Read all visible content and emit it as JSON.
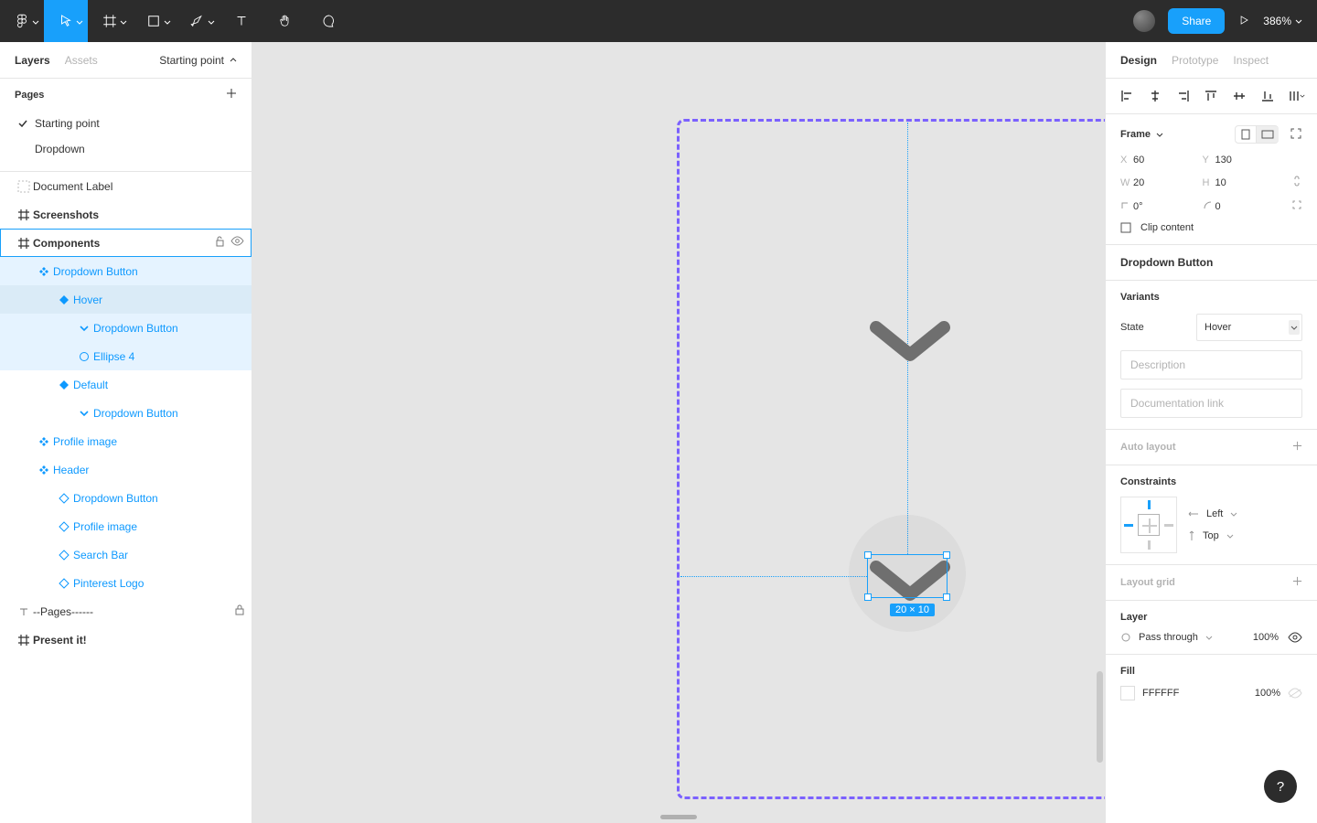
{
  "toolbar": {
    "share_label": "Share",
    "zoom_label": "386%"
  },
  "left_panel": {
    "tab_layers": "Layers",
    "tab_assets": "Assets",
    "starting_dropdown": "Starting point",
    "pages_title": "Pages",
    "pages": [
      "Starting point",
      "Dropdown"
    ],
    "layers": [
      {
        "indent": 0,
        "icon": "text-dashed",
        "label": "Document Label",
        "bold": false,
        "purple": false
      },
      {
        "indent": 0,
        "icon": "frame",
        "label": "Screenshots",
        "bold": true,
        "purple": false
      },
      {
        "indent": 0,
        "icon": "frame",
        "label": "Components",
        "bold": true,
        "purple": false,
        "box": true,
        "actions": true
      },
      {
        "indent": 1,
        "icon": "comp4",
        "label": "Dropdown Button",
        "purple": true,
        "hilite": true
      },
      {
        "indent": 2,
        "icon": "diamond",
        "label": "Hover",
        "purple": true,
        "selected": true
      },
      {
        "indent": 3,
        "icon": "chev",
        "label": "Dropdown Button",
        "purple": true,
        "hilite": true
      },
      {
        "indent": 3,
        "icon": "circle",
        "label": "Ellipse 4",
        "purple": true,
        "hilite": true
      },
      {
        "indent": 2,
        "icon": "diamond",
        "label": "Default",
        "purple": true
      },
      {
        "indent": 3,
        "icon": "chev",
        "label": "Dropdown Button",
        "purple": true
      },
      {
        "indent": 1,
        "icon": "comp4",
        "label": "Profile image",
        "purple": true
      },
      {
        "indent": 1,
        "icon": "comp4",
        "label": "Header",
        "purple": true
      },
      {
        "indent": 2,
        "icon": "diamond-o",
        "label": "Dropdown Button",
        "purple": true
      },
      {
        "indent": 2,
        "icon": "diamond-o",
        "label": "Profile image",
        "purple": true
      },
      {
        "indent": 2,
        "icon": "diamond-o",
        "label": "Search Bar",
        "purple": true
      },
      {
        "indent": 2,
        "icon": "diamond-o",
        "label": "Pinterest Logo",
        "purple": true
      },
      {
        "indent": 0,
        "icon": "text",
        "label": "--Pages------",
        "lock": true
      },
      {
        "indent": 0,
        "icon": "hash",
        "label": "Present it!",
        "bold": true
      }
    ]
  },
  "canvas": {
    "dim_label": "20 × 10"
  },
  "right_panel": {
    "tab_design": "Design",
    "tab_prototype": "Prototype",
    "tab_inspect": "Inspect",
    "frame_title": "Frame",
    "x_label": "X",
    "x_val": "60",
    "y_label": "Y",
    "y_val": "130",
    "w_label": "W",
    "w_val": "20",
    "h_label": "H",
    "h_val": "10",
    "rot_val": "0°",
    "rad_val": "0",
    "clip_label": "Clip content",
    "component_name": "Dropdown Button",
    "variants_title": "Variants",
    "variant_state_label": "State",
    "variant_state_value": "Hover",
    "description_placeholder": "Description",
    "doclink_placeholder": "Documentation link",
    "autolayout_title": "Auto layout",
    "constraints_title": "Constraints",
    "constraint_h": "Left",
    "constraint_v": "Top",
    "layoutgrid_title": "Layout grid",
    "layer_title": "Layer",
    "blend_mode": "Pass through",
    "opacity": "100%",
    "fill_title": "Fill",
    "fill_hex": "FFFFFF",
    "fill_opacity": "100%"
  }
}
